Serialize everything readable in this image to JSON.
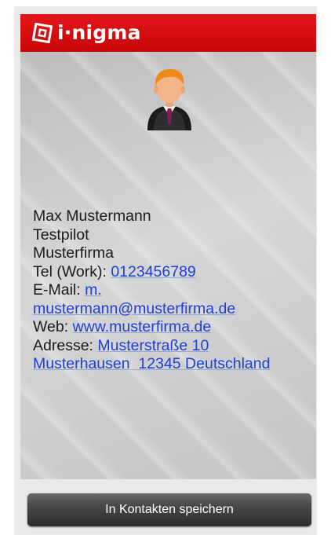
{
  "app": {
    "logo_text": "i·nigma",
    "brand_color": "#d60d0f",
    "logo_icon": "inigma-logo-icon"
  },
  "contact": {
    "avatar_icon": "person-avatar-icon",
    "name": "Max Mustermann",
    "title": "Testpilot",
    "company": "Musterfirma",
    "tel_label": "Tel (Work): ",
    "tel_value": "0123456789",
    "email_label": "E-Mail: ",
    "email_value_part1": "m.",
    "email_value_part2": "mustermann@musterfirma.de",
    "web_label": "Web: ",
    "web_value": "www.musterfirma.de",
    "address_label": "Adresse: ",
    "address_line1": "Musterstraße 10",
    "address_line2": "Musterhausen  12345 Deutschland",
    "link_color": "#1f3fd6"
  },
  "actions": {
    "save_label": "In Kontakten speichern"
  }
}
